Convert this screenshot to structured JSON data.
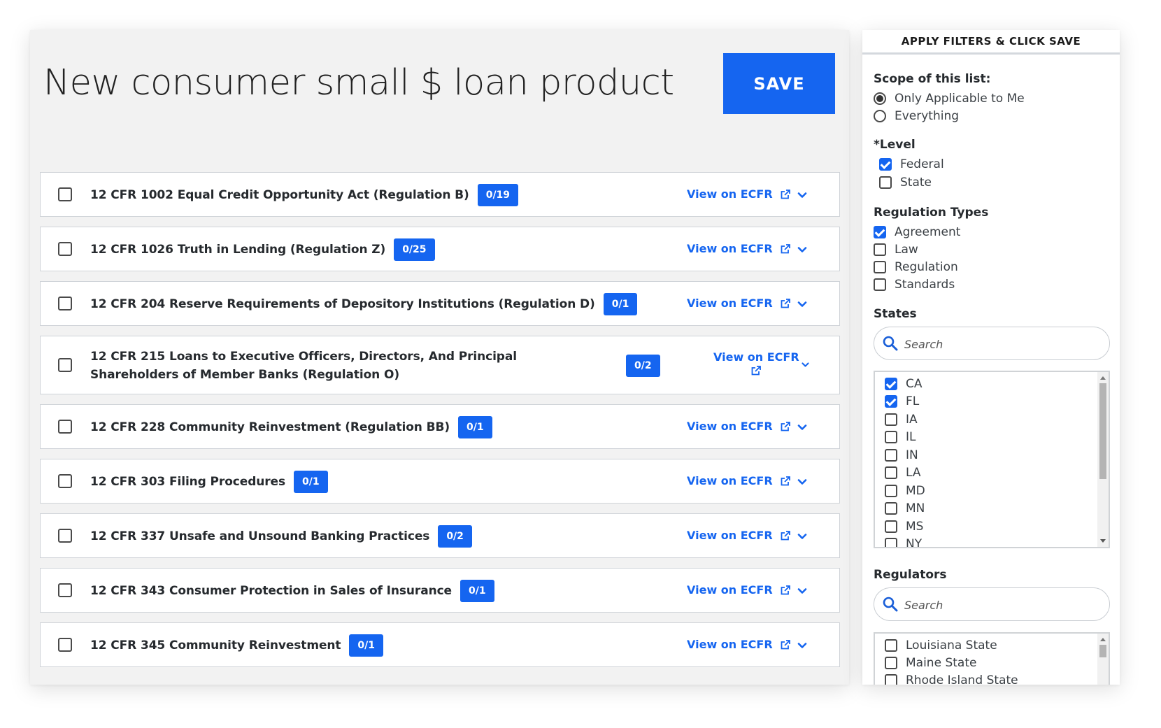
{
  "page": {
    "title": "New consumer small $ loan product",
    "save_label": "SAVE"
  },
  "regulations": [
    {
      "title": "12 CFR 1002 Equal Credit Opportunity Act (Regulation B)",
      "badge": "0/19",
      "link": "View on ECFR"
    },
    {
      "title": "12 CFR 1026 Truth in Lending (Regulation Z)",
      "badge": "0/25",
      "link": "View on ECFR"
    },
    {
      "title": "12 CFR 204 Reserve Requirements of Depository Institutions (Regulation D)",
      "badge": "0/1",
      "link": "View on ECFR"
    },
    {
      "title": "12 CFR 215 Loans to Executive Officers, Directors, And Principal Shareholders of Member Banks (Regulation O)",
      "badge": "0/2",
      "link": "View on ECFR"
    },
    {
      "title": "12 CFR 228 Community Reinvestment (Regulation BB)",
      "badge": "0/1",
      "link": "View on ECFR"
    },
    {
      "title": "12 CFR 303 Filing Procedures",
      "badge": "0/1",
      "link": "View on ECFR"
    },
    {
      "title": "12 CFR 337 Unsafe and Unsound Banking Practices",
      "badge": "0/2",
      "link": "View on ECFR"
    },
    {
      "title": "12 CFR 343 Consumer Protection in Sales of Insurance",
      "badge": "0/1",
      "link": "View on ECFR"
    },
    {
      "title": "12 CFR 345 Community Reinvestment",
      "badge": "0/1",
      "link": "View on ECFR"
    }
  ],
  "filters": {
    "header": "APPLY FILTERS & CLICK SAVE",
    "scope": {
      "title": "Scope of this list:",
      "options": [
        {
          "label": "Only Applicable to Me",
          "selected": true
        },
        {
          "label": "Everything",
          "selected": false
        }
      ]
    },
    "level": {
      "title": "*Level",
      "options": [
        {
          "label": "Federal",
          "checked": true
        },
        {
          "label": "State",
          "checked": false
        }
      ]
    },
    "regulation_types": {
      "title": "Regulation Types",
      "options": [
        {
          "label": "Agreement",
          "checked": true
        },
        {
          "label": "Law",
          "checked": false
        },
        {
          "label": "Regulation",
          "checked": false
        },
        {
          "label": "Standards",
          "checked": false
        }
      ]
    },
    "states": {
      "title": "States",
      "search_placeholder": "Search",
      "items": [
        {
          "label": "CA",
          "checked": true
        },
        {
          "label": "FL",
          "checked": true
        },
        {
          "label": "IA",
          "checked": false
        },
        {
          "label": "IL",
          "checked": false
        },
        {
          "label": "IN",
          "checked": false
        },
        {
          "label": "LA",
          "checked": false
        },
        {
          "label": "MD",
          "checked": false
        },
        {
          "label": "MN",
          "checked": false
        },
        {
          "label": "MS",
          "checked": false
        },
        {
          "label": "NY",
          "checked": false
        }
      ]
    },
    "regulators": {
      "title": "Regulators",
      "search_placeholder": "Search",
      "items": [
        {
          "label": "Louisiana State",
          "checked": false
        },
        {
          "label": "Maine State",
          "checked": false
        },
        {
          "label": "Rhode Island State",
          "checked": false
        }
      ]
    }
  },
  "colors": {
    "accent": "#1565f0",
    "panel_bg": "#f2f2f2"
  }
}
